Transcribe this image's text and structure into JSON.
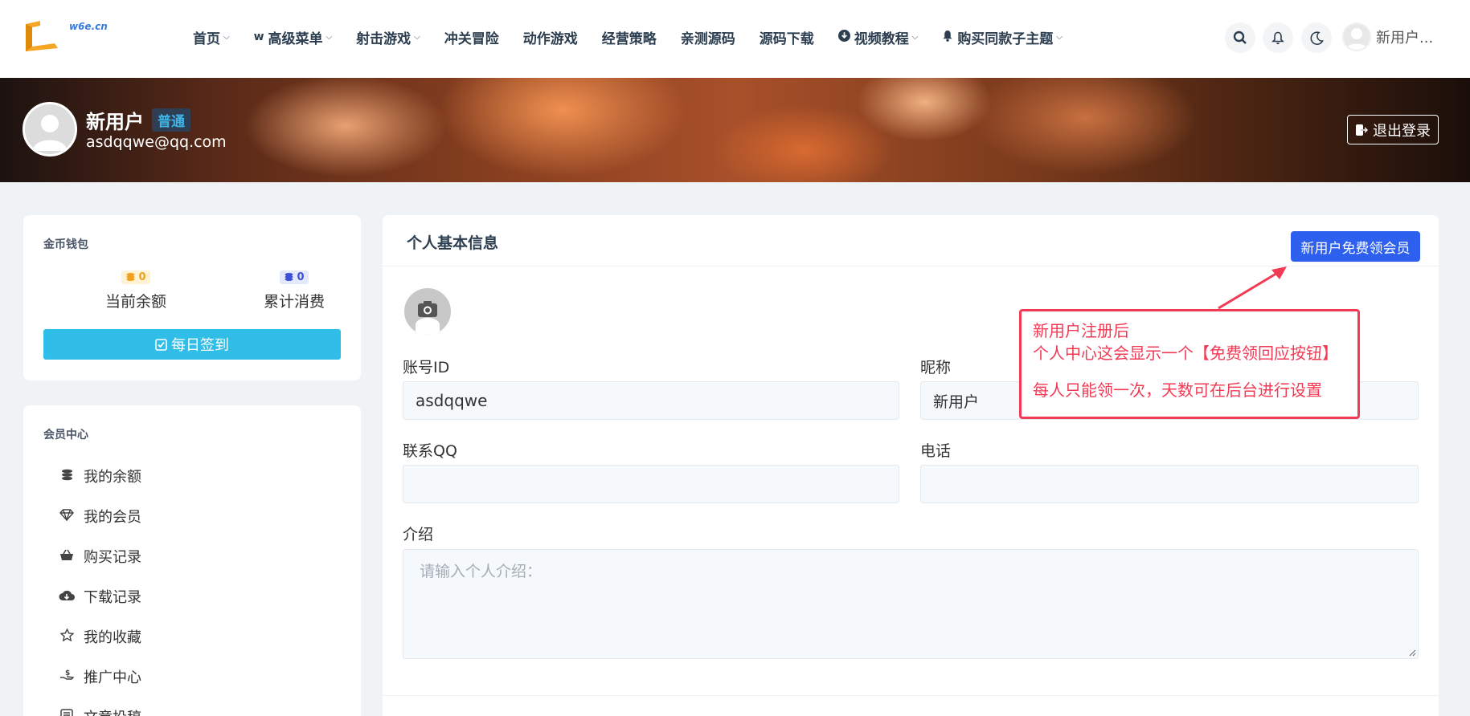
{
  "header": {
    "logo_text": "w6e.cn",
    "nav": [
      {
        "label": "首页",
        "caret": true,
        "icon": ""
      },
      {
        "label": "高级菜单",
        "caret": true,
        "icon": "w-icon"
      },
      {
        "label": "射击游戏",
        "caret": true,
        "icon": ""
      },
      {
        "label": "冲关冒险",
        "caret": false,
        "icon": ""
      },
      {
        "label": "动作游戏",
        "caret": false,
        "icon": ""
      },
      {
        "label": "经营策略",
        "caret": false,
        "icon": ""
      },
      {
        "label": "亲测源码",
        "caret": false,
        "icon": ""
      },
      {
        "label": "源码下载",
        "caret": false,
        "icon": ""
      },
      {
        "label": "视频教程",
        "caret": true,
        "icon": "download-circle-icon"
      },
      {
        "label": "购买同款子主题",
        "caret": true,
        "icon": "bell-icon"
      }
    ],
    "user_short": "新用户..."
  },
  "banner": {
    "name": "新用户",
    "badge": "普通",
    "email": "asdqqwe@qq.com",
    "logout": "退出登录"
  },
  "wallet": {
    "title": "金币钱包",
    "balance_value": "0",
    "balance_label": "当前余额",
    "spent_value": "0",
    "spent_label": "累计消费",
    "checkin_label": "每日签到"
  },
  "member": {
    "title": "会员中心",
    "items": [
      {
        "label": "我的余额",
        "icon": "coins-icon"
      },
      {
        "label": "我的会员",
        "icon": "diamond-icon"
      },
      {
        "label": "购买记录",
        "icon": "basket-icon"
      },
      {
        "label": "下载记录",
        "icon": "cloud-download-icon"
      },
      {
        "label": "我的收藏",
        "icon": "star-icon"
      },
      {
        "label": "推广中心",
        "icon": "hand-dollar-icon"
      },
      {
        "label": "文章投稿",
        "icon": "edit-icon"
      }
    ]
  },
  "profile": {
    "title": "个人基本信息",
    "vip_button": "新用户免费领会员",
    "fields": {
      "account_id_label": "账号ID",
      "account_id_value": "asdqqwe",
      "nickname_label": "昵称",
      "nickname_value": "新用户",
      "qq_label": "联系QQ",
      "qq_value": "",
      "phone_label": "电话",
      "phone_value": "",
      "intro_label": "介绍",
      "intro_placeholder": "请输入个人介绍："
    }
  },
  "annotation": {
    "line1": "新用户注册后",
    "line2": "个人中心这会显示一个【免费领回应按钮】",
    "line3": "每人只能领一次，天数可在后台进行设置"
  },
  "colors": {
    "accent": "#2e60f0",
    "checkin": "#30bde8",
    "annotation": "#f23a55"
  }
}
